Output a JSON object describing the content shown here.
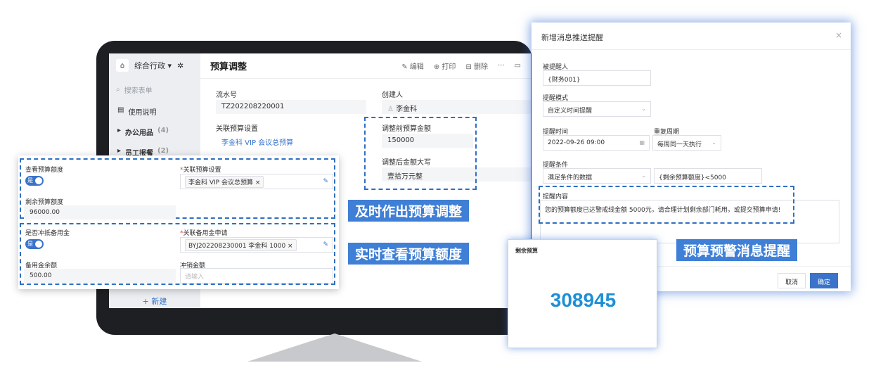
{
  "sidebar": {
    "workspace": "综合行政 ▾",
    "search": "搜索表单",
    "items": [
      {
        "label": "使用说明",
        "count": ""
      },
      {
        "label": "办公用品",
        "count": "(4)"
      },
      {
        "label": "员工报餐",
        "count": "(2)"
      }
    ],
    "new_label": "+ 新建"
  },
  "main": {
    "title": "预算调整",
    "tools": [
      "✎ 编辑",
      "⊕ 打印",
      "⊟ 删除",
      "···"
    ],
    "fields": {
      "serial_label": "流水号",
      "serial_value": "TZ202208220001",
      "creator_label": "创建人",
      "creator_value": "李金科",
      "linked_budget_label": "关联预算设置",
      "linked_budget_value": "李金科 VIP 会议总预算",
      "before_label": "调整前预算金额",
      "before_value": "150000",
      "after_upper_label": "调整后金额大写",
      "after_upper_value": "壹拾万元整"
    }
  },
  "panel": {
    "view_budget_label": "查看预算额度",
    "toggle_text": "是",
    "linked_budget_label": "关联预算设置",
    "linked_budget_tag": "李金科 VIP 会议总预算",
    "remaining_label": "剩余预算额度",
    "remaining_value": "96000.00",
    "offset_label": "是否冲抵备用金",
    "linked_petty_label": "关联备用金申请",
    "linked_petty_tag": "BYJ202208230001 李金科 1000",
    "petty_balance_label": "备用金余额",
    "petty_balance_value": "500.00",
    "writeoff_label": "冲销金额",
    "writeoff_placeholder": "请输入"
  },
  "callouts": {
    "adjust": "及时作出预算调整",
    "view": "实时查看预算额度",
    "alert": "预算预警消息提醒"
  },
  "dialog": {
    "title": "新增消息推送提醒",
    "close": "×",
    "recipient_label": "被提醒人",
    "recipient_value": "{财务001}",
    "mode_label": "提醒模式",
    "mode_value": "自定义时间提醒",
    "time_label": "提醒时间",
    "time_value": "2022-09-26 09:00",
    "repeat_label": "重复周期",
    "repeat_value": "每周同一天执行",
    "condition_label": "提醒条件",
    "condition_value": "满足条件的数据",
    "condition_expr": "{剩余预算额度}<5000",
    "content_label": "提醒内容",
    "content_value": "您的预算额度已达警戒线金额 5000元，请合理计划剩余部门耗用，或提交预算申请!",
    "cancel": "取消",
    "confirm": "确定"
  },
  "remaining_card": {
    "label": "剩余预算",
    "value": "308945"
  },
  "colors": {
    "accent": "#3a73c9",
    "callout_bg": "#3f7fd6",
    "big_number": "#1e8fd6"
  }
}
